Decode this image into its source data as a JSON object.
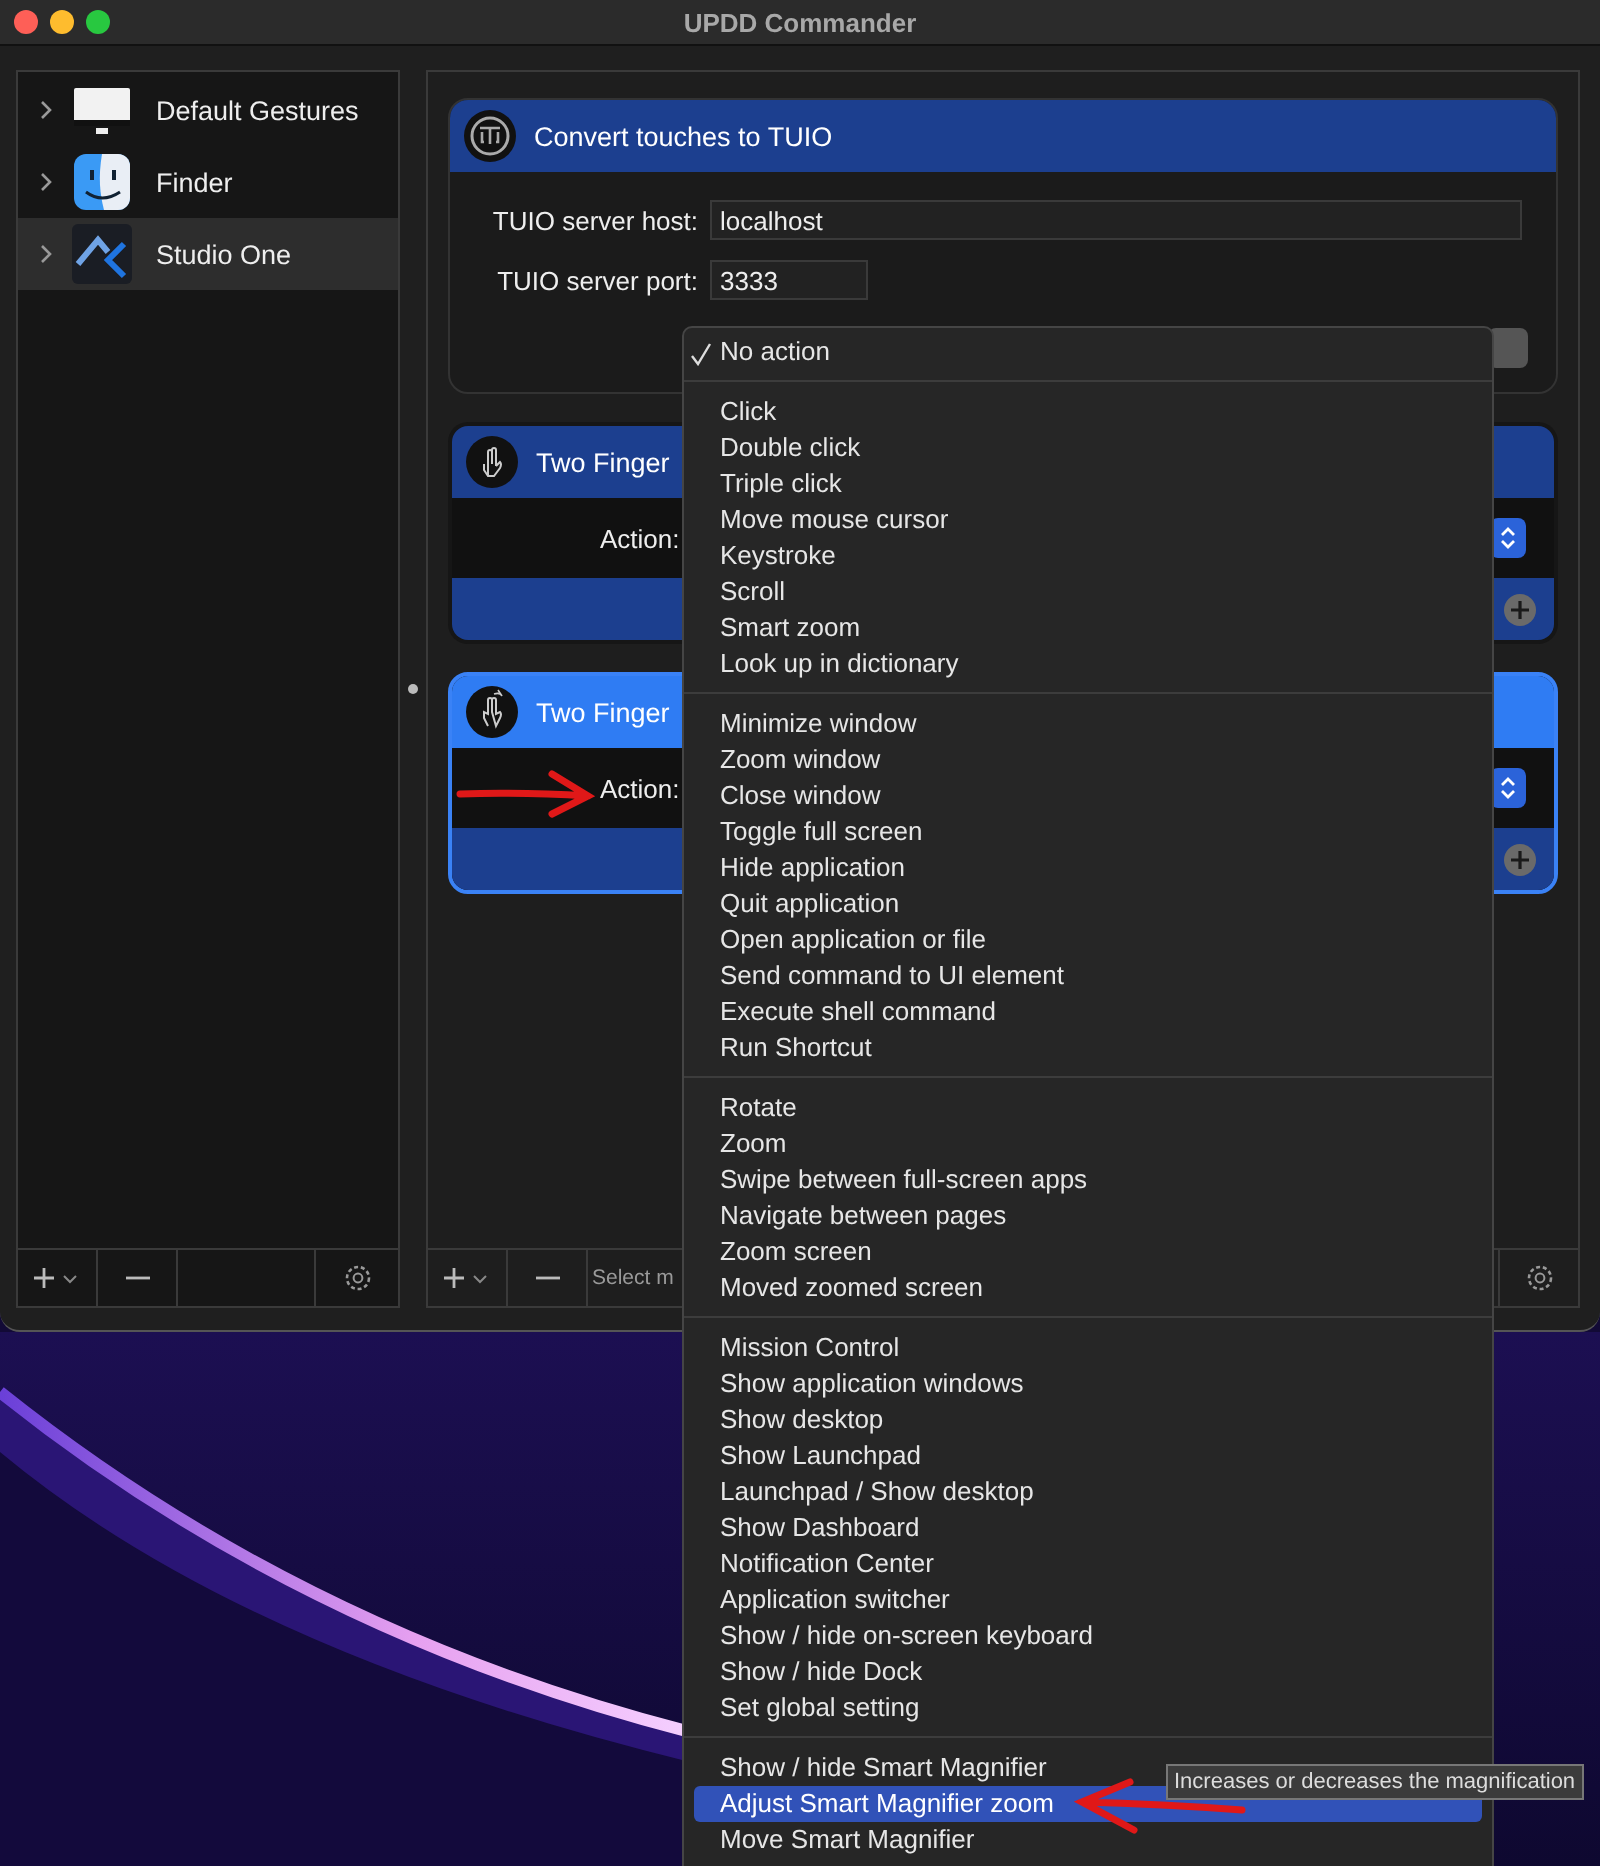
{
  "window": {
    "title": "UPDD Commander"
  },
  "sidebar": {
    "items": [
      {
        "label": "Default Gestures",
        "kind": "monitor",
        "selected": false
      },
      {
        "label": "Finder",
        "kind": "finder",
        "selected": false
      },
      {
        "label": "Studio One",
        "kind": "studio",
        "selected": true
      }
    ]
  },
  "cards": [
    {
      "kind": "tuio",
      "title": "Convert touches to TUIO",
      "selected": false,
      "fields": [
        {
          "label": "TUIO server host:",
          "value": "localhost",
          "kind": "wide"
        },
        {
          "label": "TUIO server port:",
          "value": "3333",
          "kind": "narrow"
        }
      ]
    },
    {
      "kind": "tap",
      "title": "Two Finger",
      "selected": false,
      "action_label": "Action:"
    },
    {
      "kind": "swipe",
      "title": "Two Finger",
      "selected": true,
      "action_label": "Action:"
    }
  ],
  "main_toolbar": {
    "status": "Select m"
  },
  "menu": {
    "groups": [
      {
        "items": [
          {
            "label": "No action",
            "checked": true,
            "highlighted": false
          }
        ]
      },
      {
        "items": [
          {
            "label": "Click",
            "checked": false,
            "highlighted": false
          },
          {
            "label": "Double click",
            "checked": false,
            "highlighted": false
          },
          {
            "label": "Triple click",
            "checked": false,
            "highlighted": false
          },
          {
            "label": "Move mouse cursor",
            "checked": false,
            "highlighted": false
          },
          {
            "label": "Keystroke",
            "checked": false,
            "highlighted": false
          },
          {
            "label": "Scroll",
            "checked": false,
            "highlighted": false
          },
          {
            "label": "Smart zoom",
            "checked": false,
            "highlighted": false
          },
          {
            "label": "Look up in dictionary",
            "checked": false,
            "highlighted": false
          }
        ]
      },
      {
        "items": [
          {
            "label": "Minimize window",
            "checked": false,
            "highlighted": false
          },
          {
            "label": "Zoom window",
            "checked": false,
            "highlighted": false
          },
          {
            "label": "Close window",
            "checked": false,
            "highlighted": false
          },
          {
            "label": "Toggle full screen",
            "checked": false,
            "highlighted": false
          },
          {
            "label": "Hide application",
            "checked": false,
            "highlighted": false
          },
          {
            "label": "Quit application",
            "checked": false,
            "highlighted": false
          },
          {
            "label": "Open application or file",
            "checked": false,
            "highlighted": false
          },
          {
            "label": "Send command to UI element",
            "checked": false,
            "highlighted": false
          },
          {
            "label": "Execute shell command",
            "checked": false,
            "highlighted": false
          },
          {
            "label": "Run Shortcut",
            "checked": false,
            "highlighted": false
          }
        ]
      },
      {
        "items": [
          {
            "label": "Rotate",
            "checked": false,
            "highlighted": false
          },
          {
            "label": "Zoom",
            "checked": false,
            "highlighted": false
          },
          {
            "label": "Swipe between full-screen apps",
            "checked": false,
            "highlighted": false
          },
          {
            "label": "Navigate between pages",
            "checked": false,
            "highlighted": false
          },
          {
            "label": "Zoom screen",
            "checked": false,
            "highlighted": false
          },
          {
            "label": "Moved zoomed screen",
            "checked": false,
            "highlighted": false
          }
        ]
      },
      {
        "items": [
          {
            "label": "Mission Control",
            "checked": false,
            "highlighted": false
          },
          {
            "label": "Show application windows",
            "checked": false,
            "highlighted": false
          },
          {
            "label": "Show desktop",
            "checked": false,
            "highlighted": false
          },
          {
            "label": "Show Launchpad",
            "checked": false,
            "highlighted": false
          },
          {
            "label": "Launchpad / Show desktop",
            "checked": false,
            "highlighted": false
          },
          {
            "label": "Show Dashboard",
            "checked": false,
            "highlighted": false
          },
          {
            "label": "Notification Center",
            "checked": false,
            "highlighted": false
          },
          {
            "label": "Application switcher",
            "checked": false,
            "highlighted": false
          },
          {
            "label": "Show / hide on-screen keyboard",
            "checked": false,
            "highlighted": false
          },
          {
            "label": "Show / hide Dock",
            "checked": false,
            "highlighted": false
          },
          {
            "label": "Set global setting",
            "checked": false,
            "highlighted": false
          }
        ]
      },
      {
        "items": [
          {
            "label": "Show / hide Smart Magnifier",
            "checked": false,
            "highlighted": false
          },
          {
            "label": "Adjust Smart Magnifier zoom",
            "checked": false,
            "highlighted": true
          },
          {
            "label": "Move Smart Magnifier",
            "checked": false,
            "highlighted": false
          }
        ]
      }
    ]
  },
  "tooltip": {
    "text": "Increases or decreases the magnification"
  }
}
